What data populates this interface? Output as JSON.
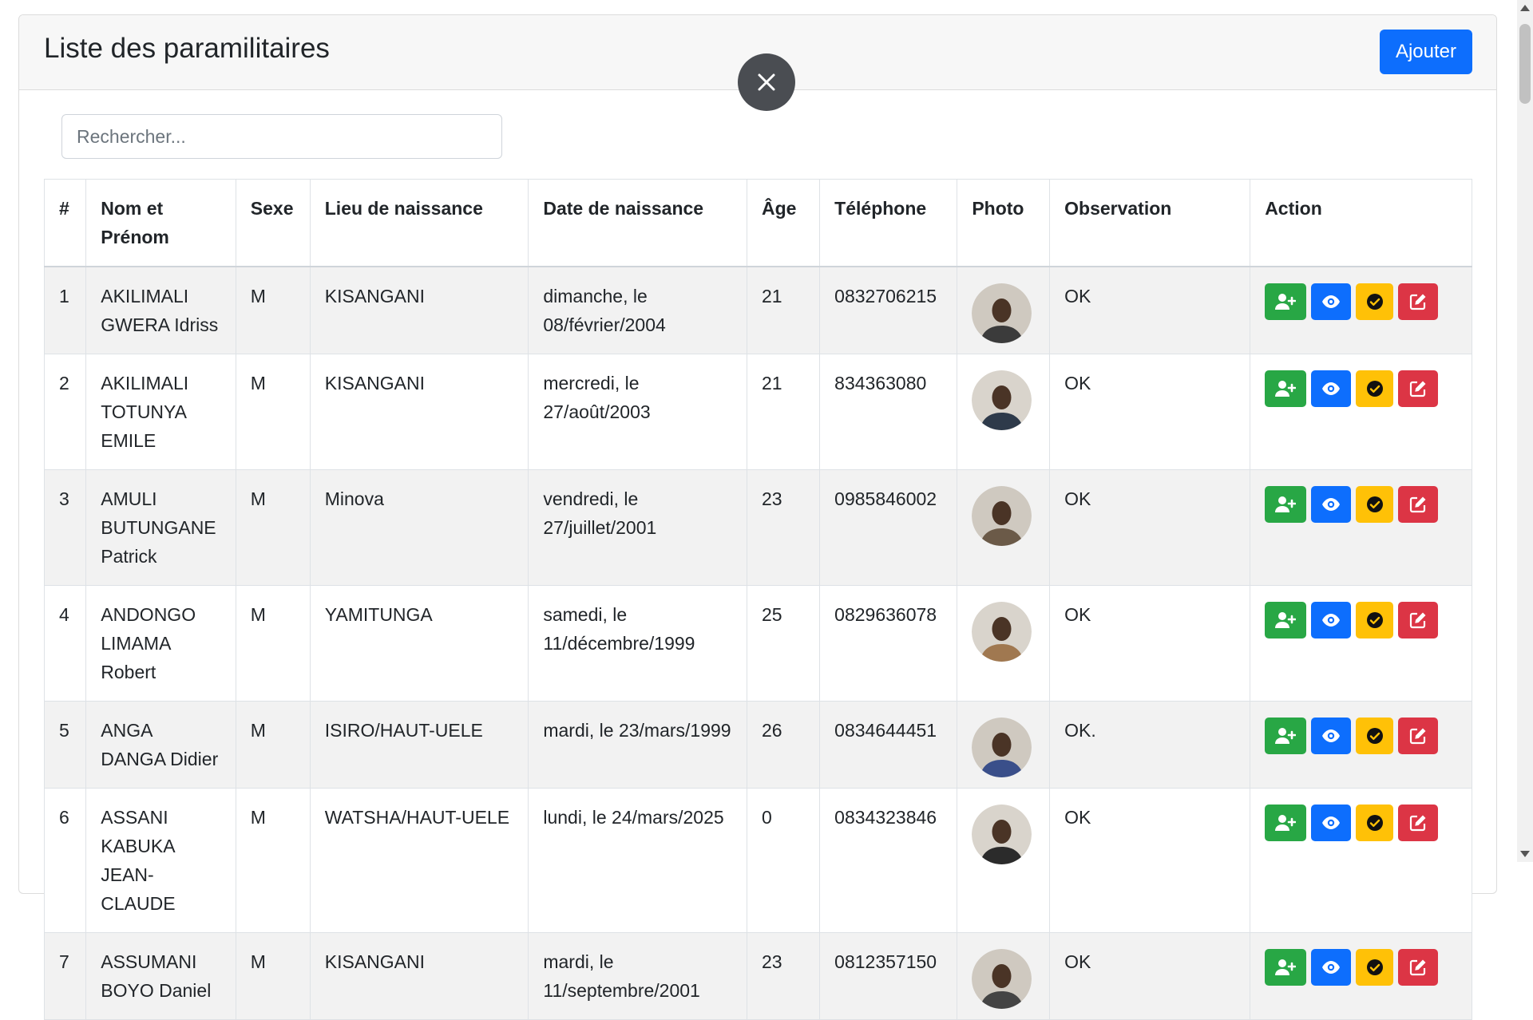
{
  "header": {
    "title": "Liste des paramilitaires",
    "add_label": "Ajouter"
  },
  "search": {
    "placeholder": "Rechercher..."
  },
  "table": {
    "columns": [
      "#",
      "Nom et Prénom",
      "Sexe",
      "Lieu de naissance",
      "Date de naissance",
      "Âge",
      "Téléphone",
      "Photo",
      "Observation",
      "Action"
    ],
    "rows": [
      {
        "num": "1",
        "name": "AKILIMALI GWERA Idriss",
        "sex": "M",
        "birthplace": "KISANGANI",
        "birthdate": "dimanche, le 08/février/2004",
        "age": "21",
        "phone": "0832706215",
        "observation": "OK"
      },
      {
        "num": "2",
        "name": "AKILIMALI TOTUNYA EMILE",
        "sex": "M",
        "birthplace": "KISANGANI",
        "birthdate": "mercredi, le 27/août/2003",
        "age": "21",
        "phone": "834363080",
        "observation": "OK"
      },
      {
        "num": "3",
        "name": "AMULI BUTUNGANE Patrick",
        "sex": "M",
        "birthplace": "Minova",
        "birthdate": "vendredi, le 27/juillet/2001",
        "age": "23",
        "phone": "0985846002",
        "observation": "OK"
      },
      {
        "num": "4",
        "name": "ANDONGO LIMAMA Robert",
        "sex": "M",
        "birthplace": "YAMITUNGA",
        "birthdate": "samedi, le 11/décembre/1999",
        "age": "25",
        "phone": "0829636078",
        "observation": "OK"
      },
      {
        "num": "5",
        "name": "ANGA DANGA Didier",
        "sex": "M",
        "birthplace": "ISIRO/HAUT-UELE",
        "birthdate": "mardi, le 23/mars/1999",
        "age": "26",
        "phone": "0834644451",
        "observation": "OK."
      },
      {
        "num": "6",
        "name": "ASSANI KABUKA JEAN-CLAUDE",
        "sex": "M",
        "birthplace": "WATSHA/HAUT-UELE",
        "birthdate": "lundi, le 24/mars/2025",
        "age": "0",
        "phone": "0834323846",
        "observation": "OK"
      },
      {
        "num": "7",
        "name": "ASSUMANI BOYO Daniel",
        "sex": "M",
        "birthplace": "KISANGANI",
        "birthdate": "mardi, le 11/septembre/2001",
        "age": "23",
        "phone": "0812357150",
        "observation": "OK"
      }
    ]
  },
  "icons": {
    "add_user": "user-plus-icon",
    "view": "eye-icon",
    "validate": "check-circle-icon",
    "edit": "edit-icon",
    "close": "close-icon"
  },
  "colors": {
    "primary": "#0d6efd",
    "success": "#28a745",
    "warning": "#ffc107",
    "danger": "#dc3545",
    "close_bg": "#4a4d52"
  }
}
